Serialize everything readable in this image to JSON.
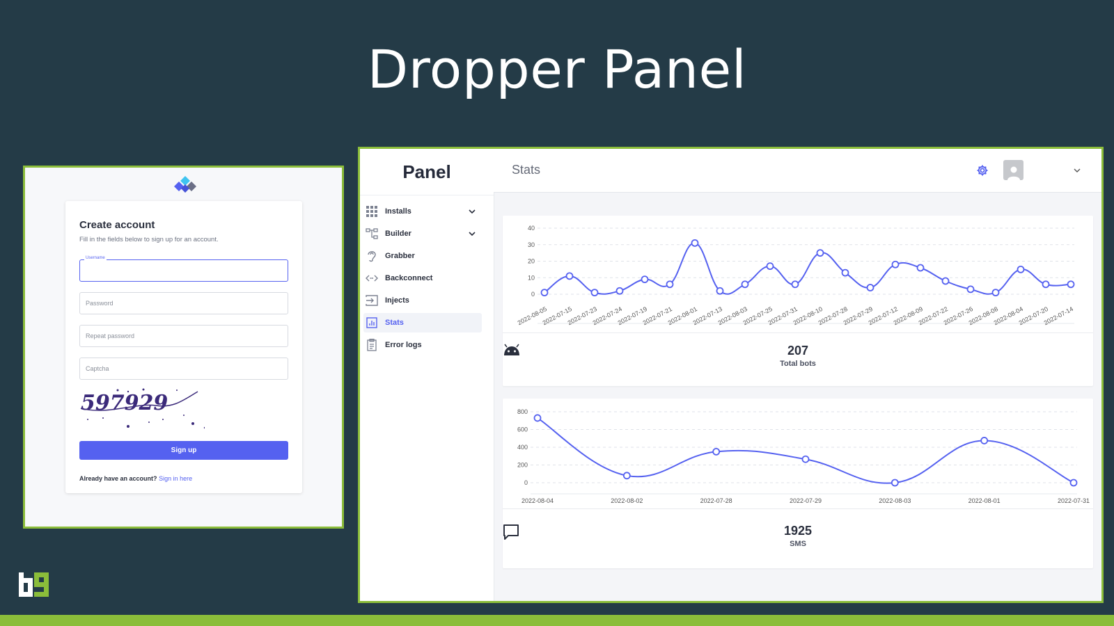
{
  "slide": {
    "title": "Dropper Panel"
  },
  "signup": {
    "title": "Create account",
    "subtitle": "Fill in the fields below to sign up for an account.",
    "username_label": "Username",
    "username_value": "",
    "password_placeholder": "Password",
    "repeat_password_placeholder": "Repeat password",
    "captcha_placeholder": "Captcha",
    "captcha_text": "597929",
    "signup_button": "Sign up",
    "have_account_text": "Already have an account?",
    "signin_link": "Sign in here",
    "accent_color": "#5561f0"
  },
  "panel": {
    "brand": "Panel",
    "page_title": "Stats",
    "nav": [
      {
        "label": "Installs",
        "icon": "grid-icon",
        "expandable": true
      },
      {
        "label": "Builder",
        "icon": "sitemap-icon",
        "expandable": true
      },
      {
        "label": "Grabber",
        "icon": "ear-icon",
        "expandable": false
      },
      {
        "label": "Backconnect",
        "icon": "code-arrows-icon",
        "expandable": false
      },
      {
        "label": "Injects",
        "icon": "import-icon",
        "expandable": false
      },
      {
        "label": "Stats",
        "icon": "chart-icon",
        "expandable": false,
        "active": true
      },
      {
        "label": "Error logs",
        "icon": "clipboard-icon",
        "expandable": false
      }
    ],
    "bots_total": "207",
    "bots_label": "Total bots",
    "sms_total": "1925",
    "sms_label": "SMS"
  },
  "chart_data": [
    {
      "type": "line",
      "title": "",
      "x": [
        "2022-08-05",
        "2022-07-15",
        "2022-07-23",
        "2022-07-24",
        "2022-07-19",
        "2022-07-21",
        "2022-08-01",
        "2022-07-13",
        "2022-08-03",
        "2022-07-25",
        "2022-07-31",
        "2022-08-10",
        "2022-07-28",
        "2022-07-29",
        "2022-07-12",
        "2022-08-09",
        "2022-07-22",
        "2022-07-26",
        "2022-08-08",
        "2022-08-04",
        "2022-07-20",
        "2022-07-14"
      ],
      "series": [
        {
          "values": [
            1,
            11,
            1,
            2,
            9,
            6,
            31,
            2,
            6,
            17,
            6,
            25,
            13,
            4,
            18,
            16,
            8,
            3,
            1,
            15,
            6,
            6
          ]
        }
      ],
      "ylim": [
        0,
        40
      ],
      "yticks": [
        0,
        10,
        20,
        30,
        40
      ],
      "color": "#5561f0",
      "grid": true
    },
    {
      "type": "line",
      "title": "",
      "x": [
        "2022-08-04",
        "2022-08-02",
        "2022-07-28",
        "2022-07-29",
        "2022-08-03",
        "2022-08-01",
        "2022-07-31"
      ],
      "series": [
        {
          "values": [
            730,
            80,
            350,
            265,
            0,
            475,
            0
          ]
        }
      ],
      "ylim": [
        0,
        800
      ],
      "yticks": [
        0,
        200,
        400,
        600,
        800
      ],
      "color": "#5561f0",
      "grid": true
    }
  ]
}
